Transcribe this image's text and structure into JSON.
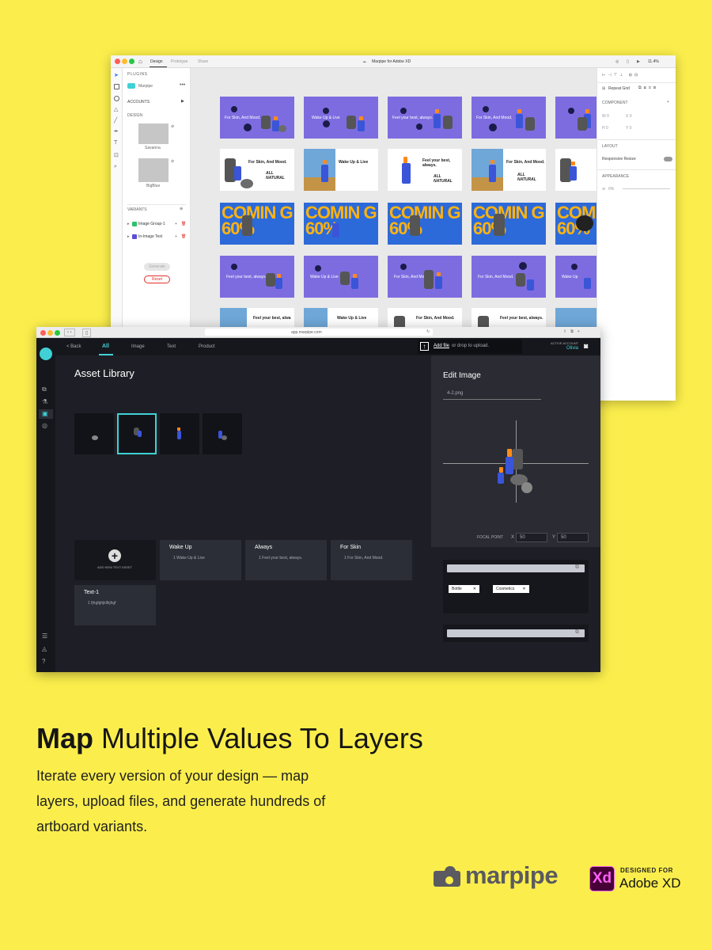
{
  "xd": {
    "tabs": [
      "Design",
      "Prototype",
      "Share"
    ],
    "doc_title": "Marpipe for Adobe XD",
    "zoom": "11.4%",
    "plugins_label": "PLUGINS",
    "plugin_name": "Marpipe",
    "accounts_label": "ACCOUNTS",
    "design_label": "DESIGN",
    "design_items": [
      "Savanna",
      "BigBlue"
    ],
    "variants_label": "VARIANTS",
    "variants": [
      "Image Group-1",
      "In-Image Text"
    ],
    "generate_label": "Generate",
    "reset_label": "Reset",
    "component_label": "COMPONENT",
    "layout_label": "LAYOUT",
    "responsive_label": "Responsive Resize",
    "appearance_label": "APPEARANCE",
    "opacity_value": "0%",
    "repeat_grid_label": "Repeat Grid"
  },
  "artboards": {
    "row1": [
      "For Skin, And Mood.",
      "Wake Up & Live",
      "Feel your best, always.",
      "For Skin, And Mood.",
      ""
    ],
    "row2": [
      "For Skin, And Mood.",
      "Wake Up & Live",
      "Feel your best, always.",
      "For Skin, And Mood.",
      ""
    ],
    "row2_badge": "ALL NATURAL",
    "promo_text": "COMIN G 60%",
    "row4": [
      "Feel your best, always.",
      "Wake Up & Live",
      "For Skin, And Mood.",
      "For Skin, And Mood.",
      "Wake Up"
    ],
    "row5": [
      "Feel your best, alwa",
      "Wake Up & Live",
      "For Skin, And Mood.",
      "Feel your best, always.",
      ""
    ]
  },
  "marpipe": {
    "url": "app.marpipe.com",
    "back_label": "< Back",
    "tabs": [
      "All",
      "Image",
      "Text",
      "Product"
    ],
    "active_tab": "All",
    "upload_link": "Add file",
    "upload_hint": "or drop to upload.",
    "account_label": "ACTIVE ACCOUNT",
    "account_name": "Olivia",
    "library_title": "Asset Library",
    "add_text_label": "ADD NEW TEXT ASSET",
    "text_assets": [
      {
        "title": "Wake Up",
        "value": "1 Wake Up & Live"
      },
      {
        "title": "Always",
        "value": "1 Feel your best, always."
      },
      {
        "title": "For Skin",
        "value": "1 For Skin, And Mood."
      },
      {
        "title": "Text-1",
        "value": "1 fjhgfghjkllkjhgf"
      }
    ],
    "edit_title": "Edit Image",
    "filename": "4-2.png",
    "focal_label": "FOCAL POINT",
    "focal_x_label": "X",
    "focal_x": "50",
    "focal_y_label": "Y",
    "focal_y": "50",
    "tags": [
      "Bottle",
      "Cosmetics"
    ]
  },
  "footer": {
    "headline_bold": "Map",
    "headline_rest": " Multiple Values To Layers",
    "desc": "Iterate every version of your design — map layers, upload files, and generate hundreds of artboard variants.",
    "brand": "marpipe",
    "xd_badge": "Xd",
    "designed_for": "DESIGNED FOR",
    "adobe_xd": "Adobe XD"
  },
  "colors": {
    "background": "#fbee4c",
    "accent": "#3fd1d6",
    "artboard_purple": "#7d6ce0",
    "artboard_blue": "#2d6ad9",
    "promo_yellow": "#ffb30f",
    "reset_red": "#e0302a"
  }
}
